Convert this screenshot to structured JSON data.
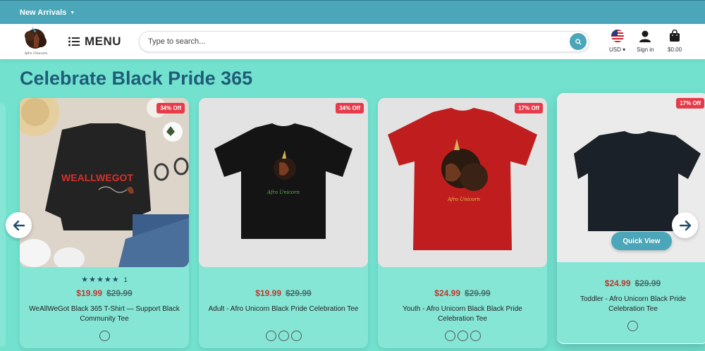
{
  "topbar": {
    "new_arrivals": "New Arrivals"
  },
  "header": {
    "menu_label": "MENU",
    "search_placeholder": "Type to search...",
    "currency": "USD",
    "signin": "Sign in",
    "cart_total": "$0.00",
    "logo_text": "Afro Unicorn"
  },
  "section": {
    "title": "Celebrate Black Pride 365"
  },
  "colors": {
    "accent": "#4aa6b8",
    "title": "#1f5c77",
    "sale": "#e63b4a",
    "background": "#72e2cf"
  },
  "products": [
    {
      "badge": "34% Off",
      "rating": 5,
      "rating_count": "1",
      "price": "$19.99",
      "old_price": "$29.99",
      "title": "WeAllWeGot Black 365 T-Shirt — Support Black Community Tee",
      "shirt_print": "WEALLWEGOT",
      "swatches": 1
    },
    {
      "badge": "34% Off",
      "price": "$19.99",
      "old_price": "$29.99",
      "title": "Adult - Afro Unicorn Black Pride Celebration Tee",
      "swatches": 3
    },
    {
      "badge": "17% Off",
      "price": "$24.99",
      "old_price": "$29.99",
      "title": "Youth - Afro Unicorn Black Black Pride Celebration Tee",
      "swatches": 3
    },
    {
      "badge": "17% Off",
      "price": "$24.99",
      "old_price": "$29.99",
      "title": "Toddler - Afro Unicorn Black Pride Celebration Tee",
      "quick_view": "Quick View",
      "swatches": 1
    }
  ]
}
